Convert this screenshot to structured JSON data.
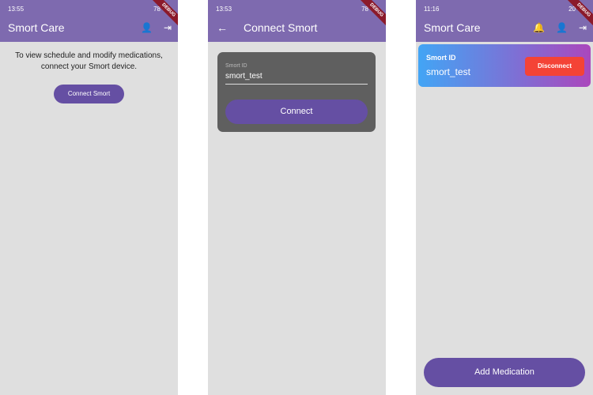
{
  "screens": [
    {
      "status_time": "13:55",
      "battery": "78",
      "title": "Smort Care",
      "debug": "DEBUG",
      "message": "To view schedule and modify medications, connect your Smort device.",
      "connect_button": "Connect Smort"
    },
    {
      "status_time": "13:53",
      "battery": "78",
      "title": "Connect Smort",
      "debug": "DEBUG",
      "field_label": "Smort ID",
      "field_value": "smort_test",
      "connect_button": "Connect"
    },
    {
      "status_time": "11:16",
      "battery": "20",
      "title": "Smort Care",
      "debug": "DEBUG",
      "card_label": "Smort ID",
      "card_value": "smort_test",
      "disconnect_button": "Disconnect",
      "add_button": "Add Medication"
    }
  ],
  "colors": {
    "appbar": "#7e6aaf",
    "button": "#654fa3",
    "disconnect": "#f44336",
    "card_gradient": [
      "#42a5f5",
      "#ab47bc"
    ]
  }
}
